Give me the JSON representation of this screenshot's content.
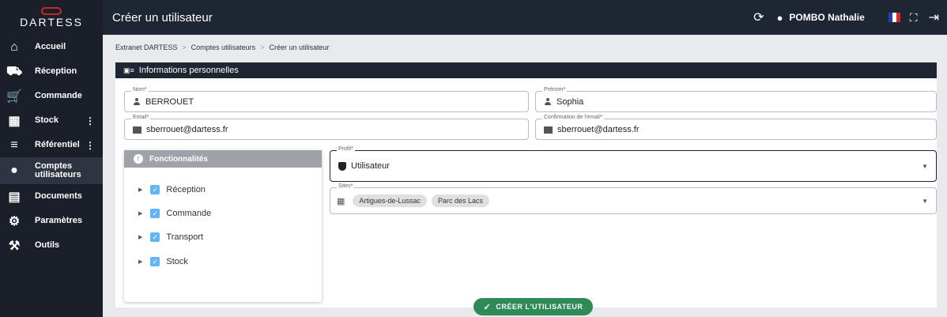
{
  "app": {
    "logo": "DARTESS",
    "title": "Créer un utilisateur"
  },
  "topbar": {
    "user_name": "POMBO Nathalie"
  },
  "sidebar": {
    "items": [
      {
        "label": "Accueil",
        "icon": "home-icon"
      },
      {
        "label": "Réception",
        "icon": "dolly-icon"
      },
      {
        "label": "Commande",
        "icon": "cart-icon"
      },
      {
        "label": "Stock",
        "icon": "warehouse-icon",
        "more": "⋮"
      },
      {
        "label": "Référentiel",
        "icon": "database-icon",
        "more": "⋮"
      },
      {
        "label": "Comptes utilisateurs",
        "icon": "user-icon"
      },
      {
        "label": "Documents",
        "icon": "document-icon"
      },
      {
        "label": "Paramètres",
        "icon": "gear-icon"
      },
      {
        "label": "Outils",
        "icon": "tools-icon"
      }
    ]
  },
  "breadcrumb": {
    "items": [
      "Extranet DARTESS",
      "Comptes utilisateurs",
      "Créer un utilisateur"
    ],
    "sep": ">"
  },
  "section": {
    "title": "Informations personnelles"
  },
  "form": {
    "nom": {
      "label": "Nom",
      "value": "BERROUET"
    },
    "prenom": {
      "label": "Prénom",
      "value": "Sophia"
    },
    "email": {
      "label": "Email",
      "value": "sberrouet@dartess.fr"
    },
    "email_confirm": {
      "label": "Confirmation de l'email",
      "value": "sberrouet@dartess.fr"
    },
    "profil": {
      "label": "Profil",
      "value": "Utilisateur"
    },
    "sites": {
      "label": "Sites",
      "values": [
        "Artigues-de-Lussac",
        "Parc des Lacs"
      ]
    },
    "required_mark": "*"
  },
  "features": {
    "title": "Fonctionnalités",
    "items": [
      "Réception",
      "Commande",
      "Transport",
      "Stock"
    ]
  },
  "actions": {
    "create_label": "CRÉER L'UTILISATEUR"
  },
  "colors": {
    "accent": "#2e8b57",
    "sidebar": "#1b1f2a",
    "topbar": "#1e2533",
    "checkbox": "#64b5f6"
  }
}
